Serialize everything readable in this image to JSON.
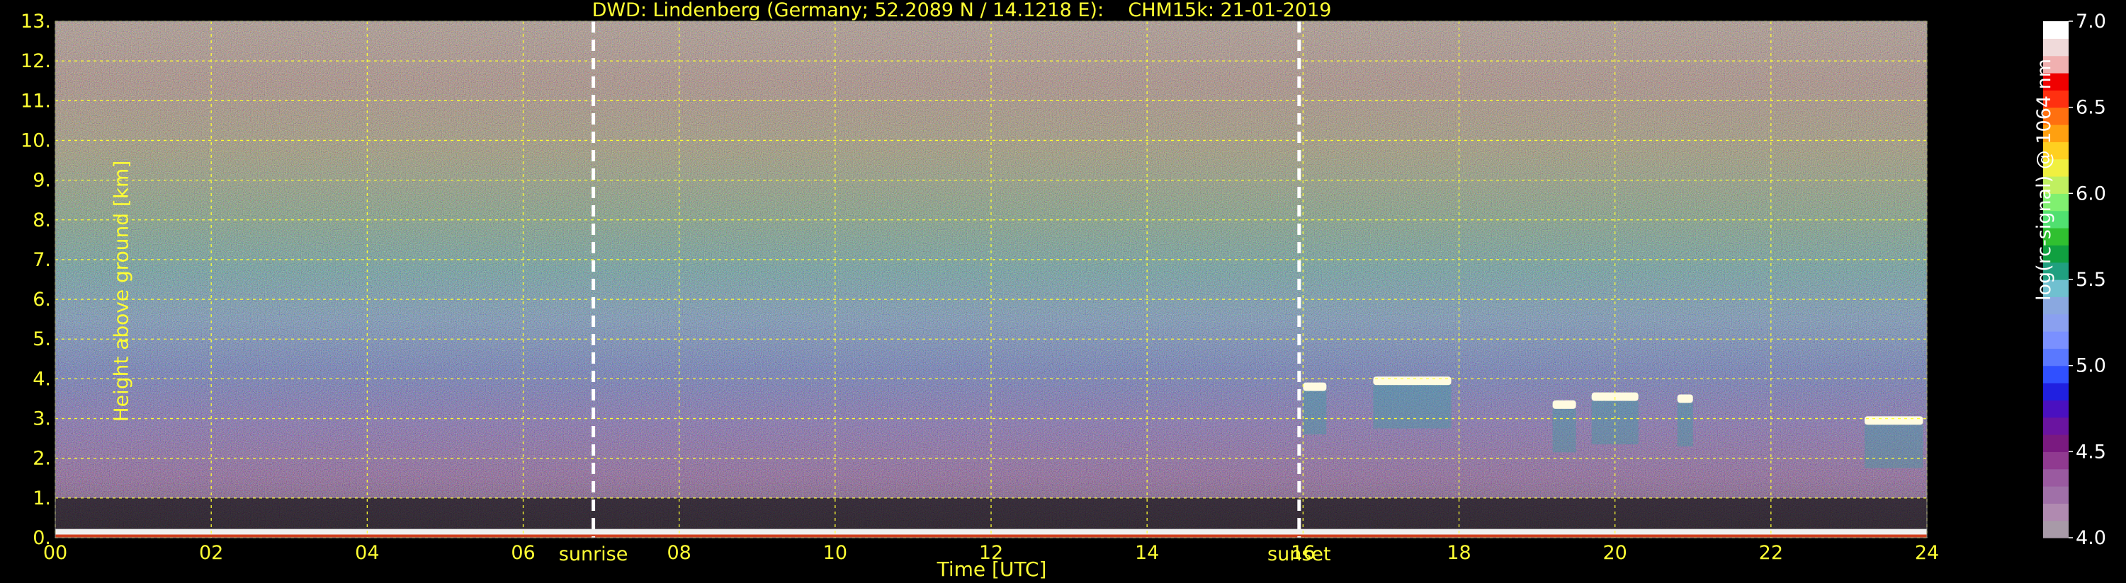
{
  "chart_data": {
    "type": "heatmap",
    "title": "DWD: Lindenberg (Germany; 52.2089 N / 14.1218 E):    CHM15k: 21-01-2019",
    "xlabel": "Time [UTC]",
    "ylabel": "Height above ground [km]",
    "xlim": [
      0,
      24
    ],
    "ylim": [
      0,
      13
    ],
    "x_ticks": [
      "00",
      "02",
      "04",
      "06",
      "08",
      "10",
      "12",
      "14",
      "16",
      "18",
      "20",
      "22",
      "24"
    ],
    "y_ticks": [
      "0.",
      "1.",
      "2.",
      "3.",
      "4.",
      "5.",
      "6.",
      "7.",
      "8.",
      "9.",
      "10.",
      "11.",
      "12.",
      "13."
    ],
    "grid": true,
    "sunrise": {
      "time": 6.9,
      "label": "sunrise"
    },
    "sunset": {
      "time": 15.95,
      "label": "sunset"
    },
    "clouds": [
      {
        "t_start": 16.0,
        "t_end": 16.3,
        "height_km": 3.8
      },
      {
        "t_start": 16.9,
        "t_end": 17.9,
        "height_km": 3.95
      },
      {
        "t_start": 19.2,
        "t_end": 19.5,
        "height_km": 3.35
      },
      {
        "t_start": 19.7,
        "t_end": 20.3,
        "height_km": 3.55
      },
      {
        "t_start": 20.8,
        "t_end": 21.0,
        "height_km": 3.5
      },
      {
        "t_start": 23.2,
        "t_end": 23.95,
        "height_km": 2.95
      }
    ],
    "colorbar": {
      "label": "log(rc-signal) @ 1064 nm",
      "range": [
        4.0,
        7.0
      ],
      "ticks": [
        "4.0",
        "4.5",
        "5.0",
        "5.5",
        "6.0",
        "6.5",
        "7.0"
      ],
      "colors": [
        "#a89aa8",
        "#b08ab0",
        "#a070a8",
        "#9a5aa0",
        "#903a90",
        "#7a1a80",
        "#6a14a0",
        "#4a10c0",
        "#2020e0",
        "#3050ff",
        "#5a78ff",
        "#7a90ff",
        "#8aa0f0",
        "#8aa8e0",
        "#70c0d0",
        "#20a080",
        "#10a040",
        "#30c030",
        "#50e070",
        "#80f070",
        "#c0f060",
        "#f0f040",
        "#ffd020",
        "#ffa010",
        "#ff7010",
        "#ff3010",
        "#f00000",
        "#f0b0b0",
        "#f0dada",
        "#ffffff"
      ]
    }
  }
}
